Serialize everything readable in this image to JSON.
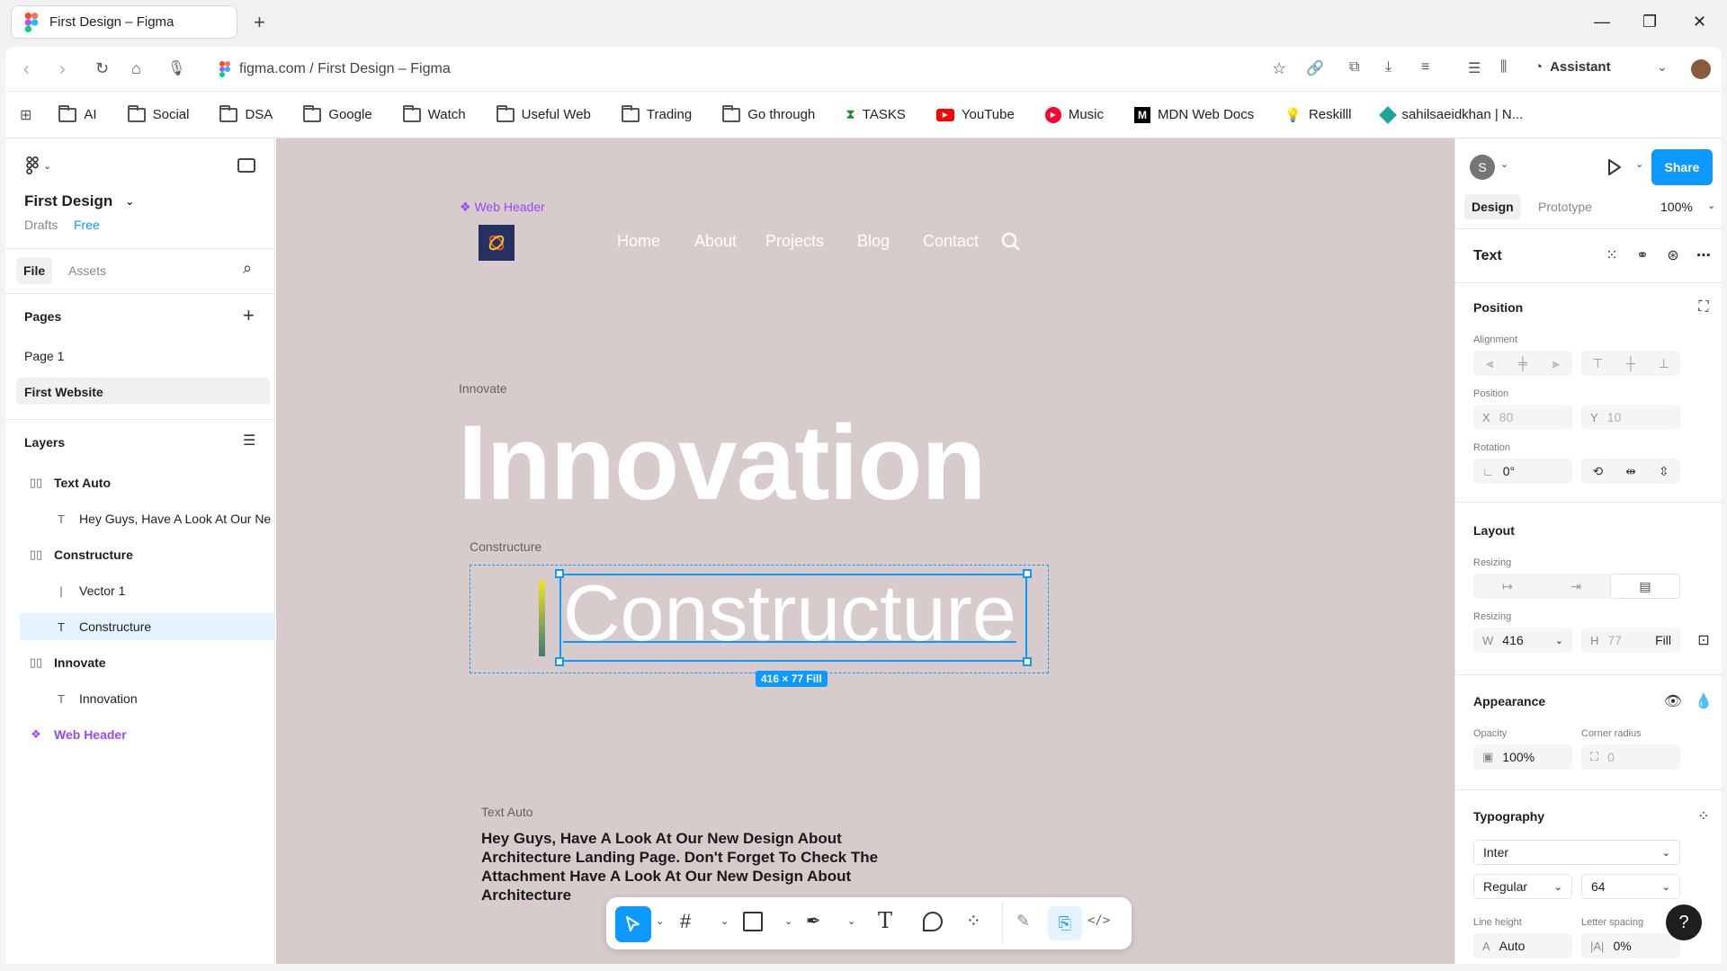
{
  "browser": {
    "tab_title": "First Design – Figma",
    "new_tab": "+",
    "url": "figma.com / First Design – Figma",
    "assistant_label": "Assistant",
    "bookmarks": [
      "AI",
      "Social",
      "DSA",
      "Google",
      "Watch",
      "Useful Web",
      "Trading",
      "Go through",
      "TASKS",
      "YouTube",
      "Music",
      "MDN Web Docs",
      "Reskilll",
      "sahilsaeidkhan | N..."
    ]
  },
  "left_panel": {
    "file_name": "First Design",
    "drafts": "Drafts",
    "plan": "Free",
    "tabs": [
      "File",
      "Assets"
    ],
    "pages_title": "Pages",
    "pages": [
      "Page 1",
      "First Website"
    ],
    "layers_title": "Layers",
    "layers": [
      {
        "name": "Text Auto",
        "type": "frame"
      },
      {
        "name": "Hey Guys, Have A Look At Our Ne",
        "type": "text"
      },
      {
        "name": "Constructure",
        "type": "frame"
      },
      {
        "name": "Vector 1",
        "type": "vector"
      },
      {
        "name": "Constructure",
        "type": "text"
      },
      {
        "name": "Innovate",
        "type": "frame"
      },
      {
        "name": "Innovation",
        "type": "text"
      },
      {
        "name": "Web Header",
        "type": "component"
      }
    ]
  },
  "canvas": {
    "web_header_label": "❖ Web Header",
    "nav": [
      "Home",
      "About",
      "Projects",
      "Blog",
      "Contact"
    ],
    "innovate_label": "Innovate",
    "innovation_text": "Innovation",
    "constructure_label": "Constructure",
    "constructure_text": "Constructure",
    "size_badge": "416 × 77 Fill",
    "text_auto_label": "Text Auto",
    "paragraph": "Hey Guys, Have A Look At Our New Design About Architecture Landing Page. Don't Forget To Check The Attachment Have A Look At Our New Design About Architecture"
  },
  "right_panel": {
    "avatar_letter": "S",
    "share": "Share",
    "tabs": [
      "Design",
      "Prototype"
    ],
    "zoom": "100%",
    "selection_type": "Text",
    "position": {
      "title": "Position",
      "alignment_label": "Alignment",
      "position_label": "Position",
      "x": "80",
      "y": "10",
      "rotation_label": "Rotation",
      "rotation": "0°"
    },
    "layout": {
      "title": "Layout",
      "resizing_label": "Resizing",
      "w": "416",
      "h": "77",
      "h_mode": "Fill"
    },
    "appearance": {
      "title": "Appearance",
      "opacity_label": "Opacity",
      "opacity": "100%",
      "corner_label": "Corner radius",
      "corner": "0"
    },
    "typography": {
      "title": "Typography",
      "font": "Inter",
      "weight": "Regular",
      "size": "64",
      "line_height_label": "Line height",
      "line_height": "Auto",
      "letter_spacing_label": "Letter spacing",
      "letter_spacing": "0%"
    },
    "help": "?"
  },
  "colors": {
    "canvas": "#d7cbcb",
    "accent": "#0d99ff",
    "component": "#9747ff"
  }
}
